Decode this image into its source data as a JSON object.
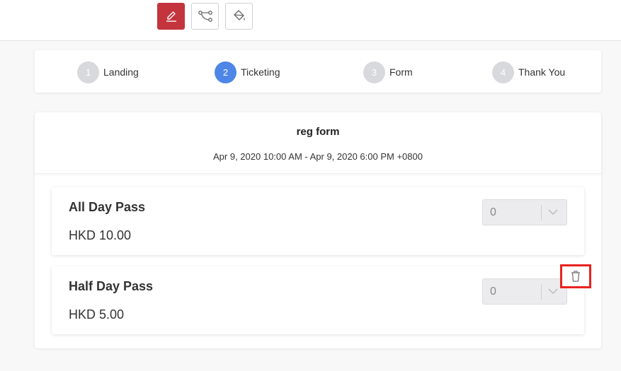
{
  "toolbar": {
    "buttons": [
      {
        "name": "edit",
        "icon": "pencil-icon",
        "active": true
      },
      {
        "name": "flow",
        "icon": "flow-nodes-icon",
        "active": false
      },
      {
        "name": "theme",
        "icon": "paint-bucket-icon",
        "active": false
      }
    ],
    "accent_color": "#c3343d"
  },
  "steps": [
    {
      "number": "1",
      "label": "Landing",
      "active": false
    },
    {
      "number": "2",
      "label": "Ticketing",
      "active": true
    },
    {
      "number": "3",
      "label": "Form",
      "active": false
    },
    {
      "number": "4",
      "label": "Thank You",
      "active": false
    }
  ],
  "event": {
    "title": "reg form",
    "date_range": "Apr 9, 2020 10:00 AM - Apr 9, 2020 6:00 PM +0800"
  },
  "tickets": [
    {
      "name": "All Day Pass",
      "price": "HKD 10.00",
      "quantity": "0"
    },
    {
      "name": "Half Day Pass",
      "price": "HKD 5.00",
      "quantity": "0"
    }
  ],
  "delete_icon": "trash-icon",
  "colors": {
    "active_step": "#4d86e6",
    "inactive_step": "#d8d9dc",
    "highlight": "#e8231f"
  }
}
